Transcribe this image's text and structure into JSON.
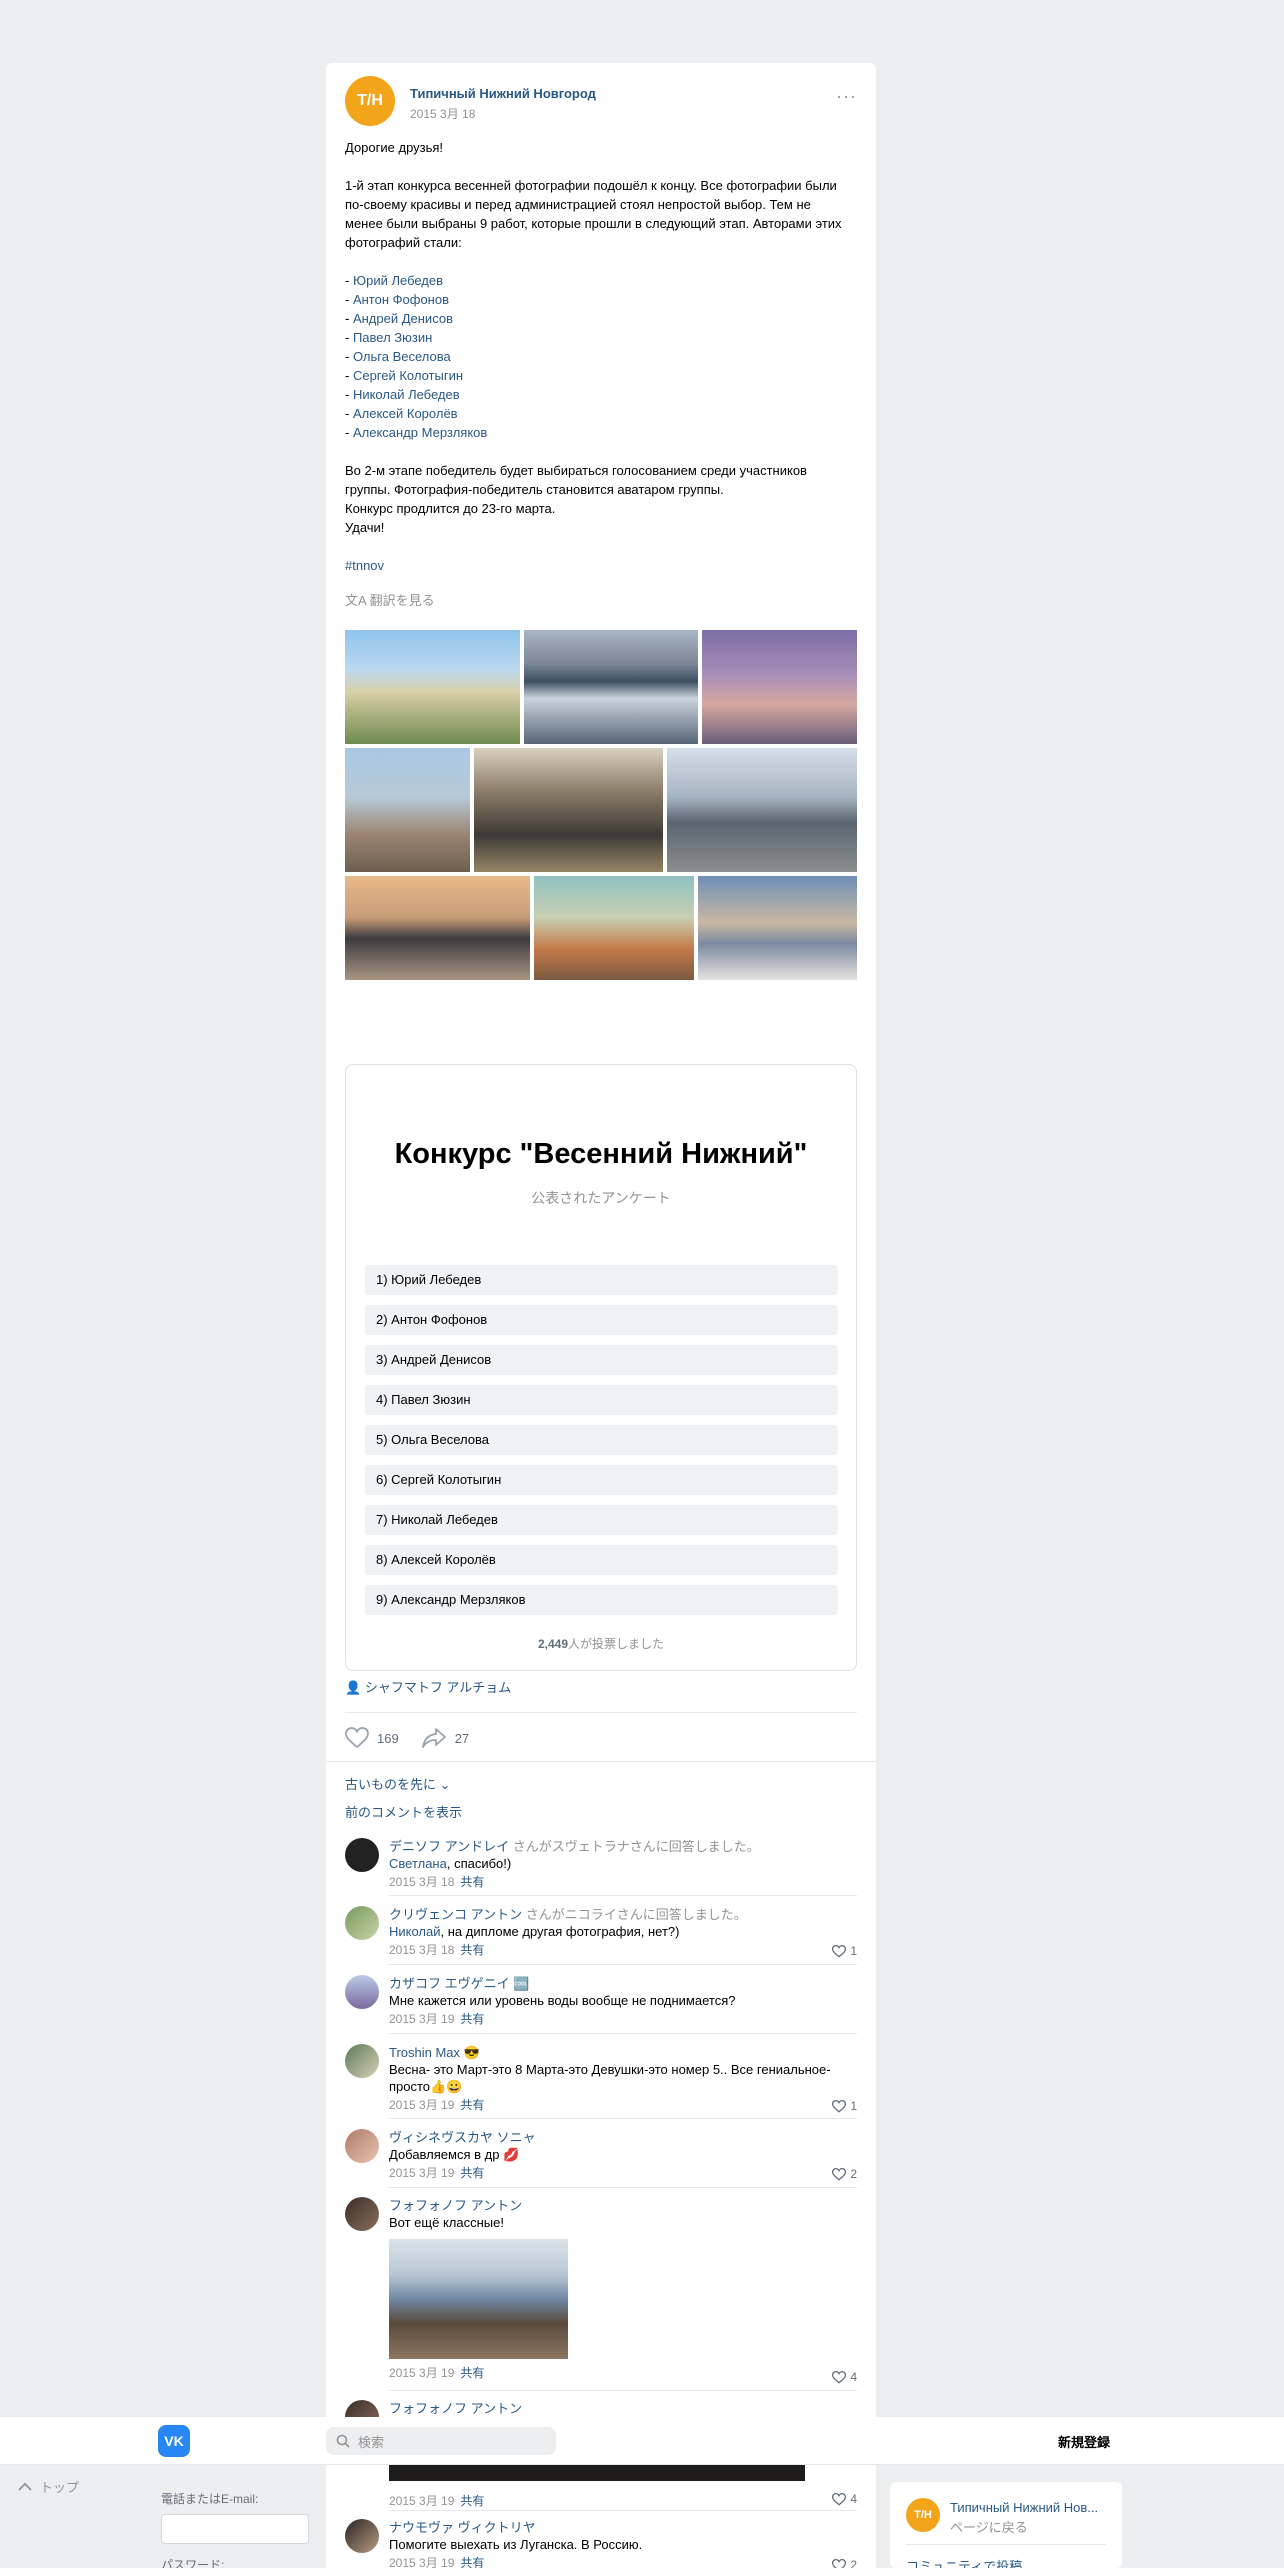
{
  "post": {
    "group_avatar_text": "Т/Н",
    "group_name": "Типичный Нижний Новгород",
    "date": "2015 3月 18",
    "more": "···",
    "greeting": "Дорогие друзья!",
    "para1_l1": "1-й этап конкурса весенней фотографии подошёл к концу. Все фотографии были",
    "para1_l2": "по-своему красивы и перед администрацией стоял непростой выбор. Тем не",
    "para1_l3": "менее были выбраны 9 работ, которые прошли в следующий этап. Авторами этих",
    "para1_l4": "фотографий стали:",
    "authors": [
      "Юрий Лебедев",
      "Антон Фофонов",
      "Андрей Денисов",
      "Павел Зюзин",
      "Ольга Веселова",
      "Сергей Колотыгин",
      "Николай Лебедев",
      "Алексей Королёв",
      "Александр Мерзляков"
    ],
    "para2_l1": "Во 2-м этапе победитель будет выбираться голосованием среди участников",
    "para2_l2": "группы. Фотография-победитель становится аватаром группы.",
    "para2_l3": "Конкурс продлится до 23-го марта.",
    "para2_l4": "Удачи!",
    "hashtag": "#tnnov",
    "translate": "翻訳を見る"
  },
  "poll": {
    "title": "Конкурс \"Весенний Нижний\"",
    "subtitle": "公表されたアンケート",
    "options": [
      "1) Юрий Лебедев",
      "2) Антон Фофонов",
      "3) Андрей Денисов",
      "4) Павел Зюзин",
      "5) Ольга Веселова",
      "6) Сергей Колотыгин",
      "7) Николай Лебедев",
      "8) Алексей Королёв",
      "9) Александр Мерзляков"
    ],
    "votes_count": "2,449",
    "votes_suffix": "人が投票しました"
  },
  "author": "シャフマトフ アルチョム",
  "actions": {
    "likes": "169",
    "shares": "27"
  },
  "comments_header": {
    "sort": "古いものを先に",
    "previous": "前のコメントを表示"
  },
  "comments": [
    {
      "name": "デニソフ アンドレイ",
      "reply": " さんがスヴェトラナさんに回答しました。",
      "reply_to": "Светлана",
      "text": ", спасибо!)",
      "date": "2015 3月 18",
      "share": "共有",
      "likes": ""
    },
    {
      "name": "クリヴェンコ アントン",
      "reply": " さんがニコライさんに回答しました。",
      "reply_to": "Николай",
      "text": ", на дипломе другая фотография, нет?)",
      "date": "2015 3月 18",
      "share": "共有",
      "likes": "1"
    },
    {
      "name": "カザコフ エヴゲニイ",
      "badge": "🆒",
      "text": "Мне кажется или уровень воды вообще не поднимается?",
      "date": "2015 3月 19",
      "share": "共有",
      "likes": ""
    },
    {
      "name": "Troshin Max",
      "badge": "😎",
      "text": "Весна- это Март-это 8 Марта-это Девушки-это номер 5.. Все гениальное-",
      "text2": "просто👍😀",
      "date": "2015 3月 19",
      "share": "共有",
      "likes": "1"
    },
    {
      "name": "ヴィシネヴスカヤ ソニャ",
      "text": "Добавляемся в др 💋",
      "date": "2015 3月 19",
      "share": "共有",
      "likes": "2"
    },
    {
      "name": "フォフォノフ アントン",
      "text": "Вот ещё классные!",
      "date": "2015 3月 19",
      "share": "共有",
      "likes": "4"
    },
    {
      "name": "フォフォノフ アントン",
      "date": "2015 3月 19",
      "share": "共有",
      "likes": "4"
    },
    {
      "name": "ナウモヴァ ヴィクトリヤ",
      "text": "Помогите выехать из Луганска. В Россию.",
      "date": "2015 3月 19",
      "share": "共有",
      "likes": "2"
    }
  ],
  "topbar": {
    "logo": "VK",
    "search_placeholder": "検索",
    "signup": "新規登録"
  },
  "left": {
    "to_top": "トップ",
    "email_label": "電話またはE-mail:",
    "password_label": "パスワード:"
  },
  "side": {
    "avatar_text": "Т/Н",
    "name": "Типичный Нижний Нов...",
    "back": "ページに戻る",
    "link": "コミュニティで投稿"
  }
}
